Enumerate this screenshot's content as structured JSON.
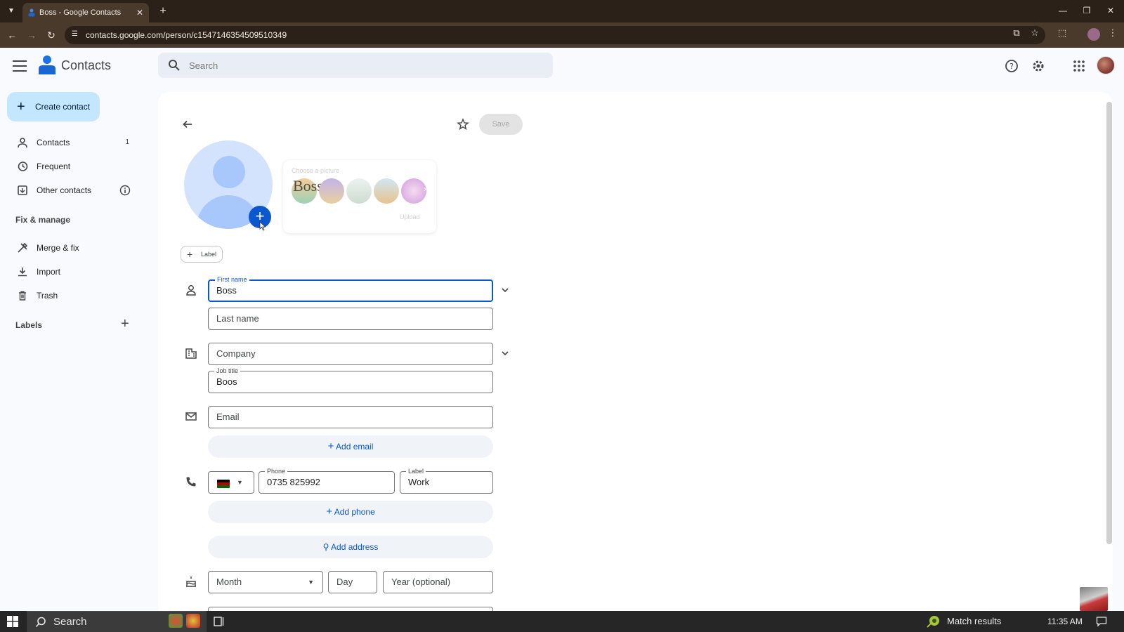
{
  "browser": {
    "tab_title": "Boss - Google Contacts",
    "tab_close": "✕",
    "new_tab": "+",
    "url": "contacts.google.com/person/c1547146354509510349"
  },
  "header": {
    "app_title": "Contacts",
    "search_placeholder": "Search"
  },
  "sidebar": {
    "create_label": "Create contact",
    "items": [
      {
        "label": "Contacts",
        "count": "1",
        "icon": "person-icon"
      },
      {
        "label": "Frequent",
        "icon": "history-icon"
      },
      {
        "label": "Other contacts",
        "icon": "archive-icon"
      }
    ],
    "fix_manage_heading": "Fix & manage",
    "manage_items": [
      {
        "label": "Merge & fix",
        "icon": "merge-fix-icon"
      },
      {
        "label": "Import",
        "icon": "download-icon"
      },
      {
        "label": "Trash",
        "icon": "trash-icon"
      }
    ],
    "labels_heading": "Labels"
  },
  "editor": {
    "save_label": "Save",
    "picture_picker_title": "Choose a picture",
    "picture_picker_boss_text": "Boss",
    "picture_picker_upload": "Upload",
    "label_chip": "Label",
    "first_name_label": "First name",
    "first_name_value": "Boss",
    "last_name_placeholder": "Last name",
    "company_placeholder": "Company",
    "job_title_label": "Job title",
    "job_title_value": "Boos",
    "email_placeholder": "Email",
    "add_email": "Add email",
    "phone_label": "Phone",
    "phone_value": "0735 825992",
    "phone_type_label": "Label",
    "phone_type_value": "Work",
    "add_phone": "Add phone",
    "add_address": "Add address",
    "birthday_month": "Month",
    "birthday_day": "Day",
    "birthday_year": "Year (optional)"
  },
  "taskbar": {
    "search_label": "Search",
    "match_results": "Match results",
    "time": "11:35 AM"
  },
  "colors": {
    "accent": "#0b57d0",
    "create_bg": "#c2e7ff",
    "avatar_bg": "#d3e3fd",
    "flag_black": "#000000",
    "flag_red": "#bb0000",
    "flag_green": "#006600"
  }
}
